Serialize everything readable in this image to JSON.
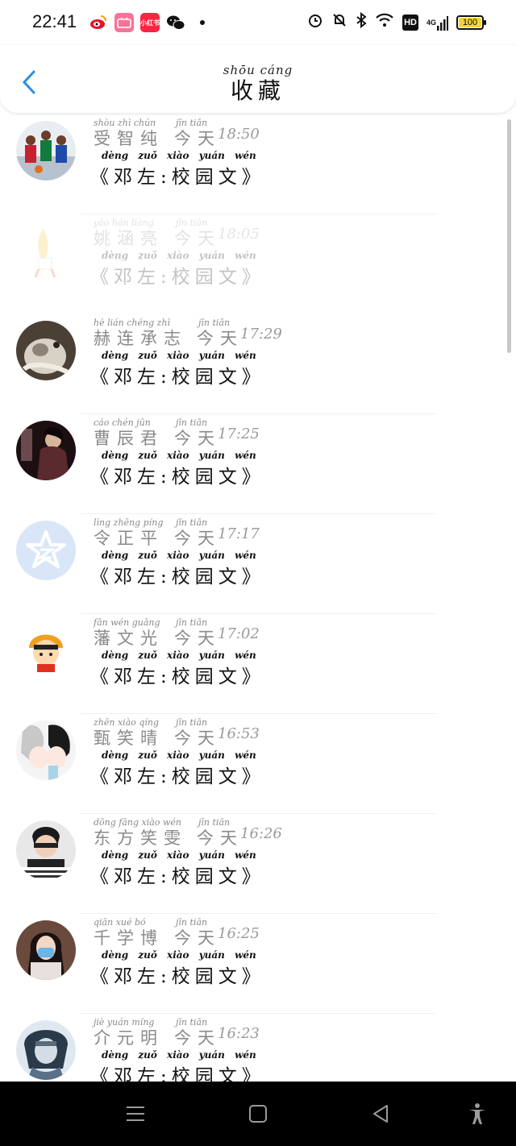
{
  "status_bar": {
    "time": "22:41",
    "battery": "100",
    "network": "4G",
    "hd": "HD",
    "app_icons": [
      "weibo-icon",
      "bilibili-icon",
      "xiaohongshu-icon",
      "wechat-icon"
    ],
    "xiaohongshu_label": "小红书"
  },
  "header": {
    "title_pinyin": "shōu cáng",
    "title": "收藏"
  },
  "accent": "#2a8ee8",
  "message": {
    "pinyin": "dèng zuǒ xiào yuán wén",
    "text": "《邓左:校园文》"
  },
  "today_pinyin": "jīn tiān",
  "today": "今天",
  "rows": [
    {
      "name_py": "shòu zhì chún",
      "name": "受智纯",
      "time": "18:50",
      "avatar": "basketball"
    },
    {
      "name_py": "yáo hán liàng",
      "name": "姚涵亮",
      "time": "18:05",
      "avatar": "banana",
      "faded": true
    },
    {
      "name_py": "hè lián chéng zhì",
      "name": "赫连承志",
      "time": "17:29",
      "avatar": "cat"
    },
    {
      "name_py": "cáo chén jūn",
      "name": "曹辰君",
      "time": "17:25",
      "avatar": "girl"
    },
    {
      "name_py": "lìng zhēng píng",
      "name": "令正平",
      "time": "17:17",
      "avatar": "qzone"
    },
    {
      "name_py": "fān wén guāng",
      "name": "藩文光",
      "time": "17:02",
      "avatar": "cartoon"
    },
    {
      "name_py": "zhēn xiào qíng",
      "name": "甄笑晴",
      "time": "16:53",
      "avatar": "anime"
    },
    {
      "name_py": "dōng fāng xiào wén",
      "name": "东方笑雯",
      "time": "16:26",
      "avatar": "boy"
    },
    {
      "name_py": "qiān xué bó",
      "name": "千学博",
      "time": "16:25",
      "avatar": "mask-girl"
    },
    {
      "name_py": "jiè yuán míng",
      "name": "介元明",
      "time": "16:23",
      "avatar": "ninja"
    }
  ],
  "nav": [
    "menu-icon",
    "home-icon",
    "back-icon",
    "accessibility-icon"
  ]
}
